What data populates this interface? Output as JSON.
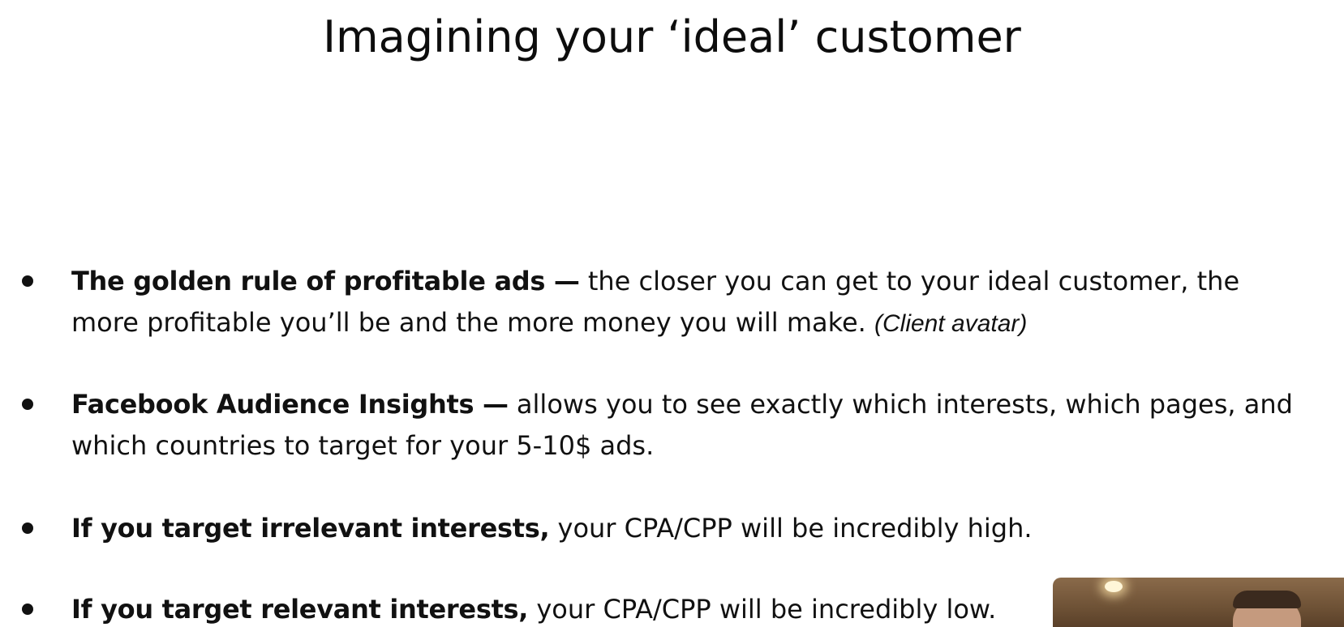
{
  "slide": {
    "title": "Imagining your ‘ideal’ customer",
    "bullets": [
      {
        "bold": "The golden rule of profitable ads —",
        "text": " the closer you can get to your ideal customer, the more profitable you’ll be and the more money you will make. ",
        "note": "(Client avatar)"
      },
      {
        "bold": "Facebook Audience Insights —",
        "text": " allows you to see exactly which interests, which pages, and which countries to target for your 5-10$ ads."
      },
      {
        "bold": "If you target irrelevant interests,",
        "text": " your CPA/CPP will be incredibly high."
      },
      {
        "bold": "If you target relevant interests,",
        "text": " your CPA/CPP will be incredibly low."
      }
    ]
  },
  "colors": {
    "background": "#ffffff",
    "text": "#111111"
  },
  "icons": {
    "bullet": "bullet-dot",
    "webcam": "webcam-overlay"
  }
}
